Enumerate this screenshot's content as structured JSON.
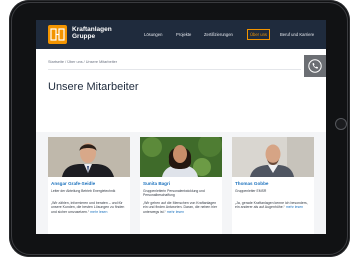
{
  "brand": {
    "name_line1": "Kraftanlagen",
    "name_line2": "Gruppe",
    "color": "#f29400",
    "header_bg": "#1f2b3d"
  },
  "nav": {
    "items": [
      {
        "label": "Lösungen"
      },
      {
        "label": "Projekte"
      },
      {
        "label": "Zertifizierungen"
      },
      {
        "label": "Über uns",
        "active": true
      },
      {
        "label": "Beruf und Karriere"
      }
    ]
  },
  "breadcrumb": "Startseite / Über uns / Unsere Mitarbeiter",
  "contact": {
    "icon": "phone-icon"
  },
  "page": {
    "title": "Unsere Mitarbeiter"
  },
  "team": [
    {
      "name": "Ansgar Grafe-Seidle",
      "role": "Leiter der Abteilung Betrieb Energietechnik",
      "quote": "„Wir zählen, informieren und beraten – und für unsere Kunden, die besten Lösungen zu finden und sicher umzusetzen.“",
      "more": "mehr lesen"
    },
    {
      "name": "Sunita Bagri",
      "role": "Gruppenleiterin Personalentwicklung und Personalbeschaffung",
      "quote": "„Wir gehen auf die Menschen von Kraftanlagen ein und finden Antworten. Daran, die neben hier unterwegs ist.“",
      "more": "mehr lesen"
    },
    {
      "name": "Thomas Gobbe",
      "role": "Gruppenleiter EMSR",
      "quote": "„Ja, gerade Kraftanlagen kenne ich besonders, ein anderer als auf Augenhöhe.“",
      "more": "mehr lesen"
    }
  ]
}
